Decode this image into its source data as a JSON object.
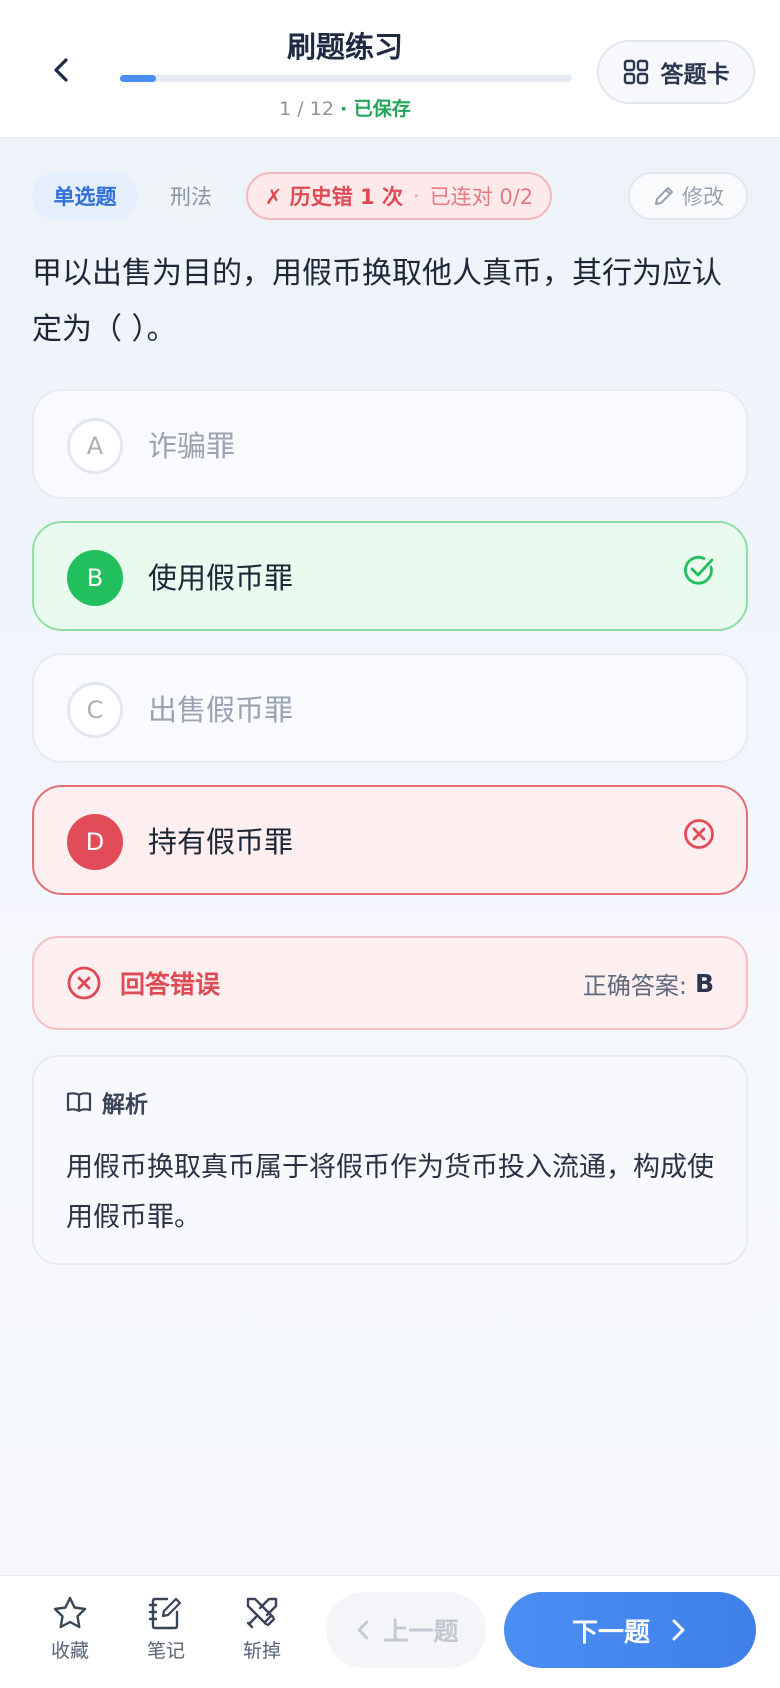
{
  "header": {
    "title": "刷题练习",
    "progress_current": 1,
    "progress_total": 12,
    "progress_text": "1 / 12",
    "progress_fraction": 0.08,
    "saved_label": "· 已保存",
    "answer_card_label": "答题卡"
  },
  "tags": {
    "type": "单选题",
    "subject": "刑法",
    "history_wrong": "✗ 历史错 1 次",
    "history_separator": "·",
    "streak": "已连对 0/2",
    "edit_label": "修改"
  },
  "question": {
    "text": "甲以出售为目的，用假币换取他人真币，其行为应认定为（ ）。"
  },
  "options": [
    {
      "letter": "A",
      "text": "诈骗罪",
      "state": "neutral"
    },
    {
      "letter": "B",
      "text": "使用假币罪",
      "state": "correct"
    },
    {
      "letter": "C",
      "text": "出售假币罪",
      "state": "neutral"
    },
    {
      "letter": "D",
      "text": "持有假币罪",
      "state": "wrong"
    }
  ],
  "result": {
    "status": "回答错误",
    "answer_label": "正确答案:",
    "answer_value": "B"
  },
  "analysis": {
    "heading": "解析",
    "body": "用假币换取真币属于将假币作为货币投入流通，构成使用假币罪。"
  },
  "bottom_bar": {
    "favorite_label": "收藏",
    "notes_label": "笔记",
    "remove_label": "斩掉",
    "prev_label": "上一题",
    "next_label": "下一题"
  },
  "colors": {
    "accent": "#4a8ef0",
    "correct": "#22bf5f",
    "wrong": "#e24b58",
    "saved": "#22a45a"
  }
}
